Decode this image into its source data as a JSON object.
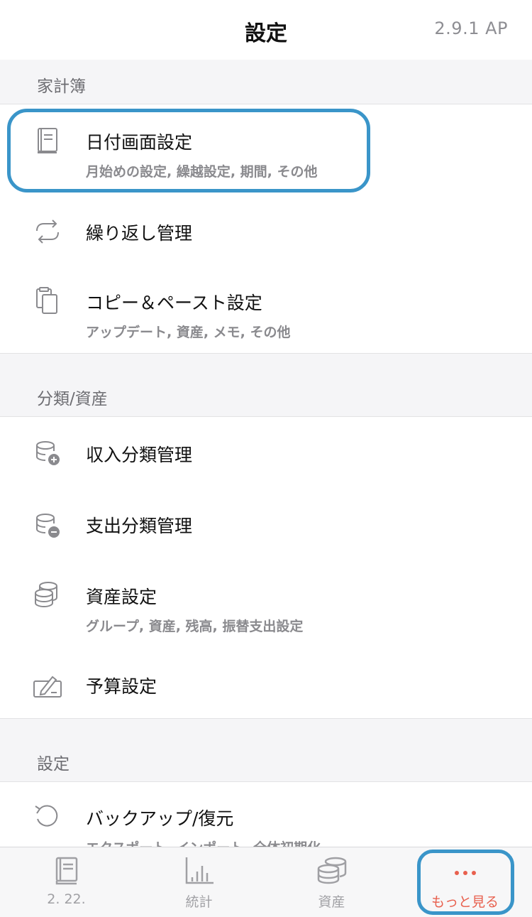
{
  "header": {
    "title": "設定",
    "version": "2.9.1 AP"
  },
  "sections": {
    "household": {
      "label": "家計簿",
      "items": [
        {
          "title": "日付画面設定",
          "subtitle": "月始めの設定, 繰越設定, 期間, その他",
          "icon": "book-icon"
        },
        {
          "title": "繰り返し管理",
          "icon": "repeat-icon"
        },
        {
          "title": "コピー＆ペースト設定",
          "subtitle": "アップデート, 資産, メモ, その他",
          "icon": "clipboard-icon"
        }
      ]
    },
    "category": {
      "label": "分類/資産",
      "items": [
        {
          "title": "収入分類管理",
          "icon": "coins-plus-icon"
        },
        {
          "title": "支出分類管理",
          "icon": "coins-minus-icon"
        },
        {
          "title": "資産設定",
          "subtitle": "グループ, 資産, 残高, 振替支出設定",
          "icon": "coins-icon"
        },
        {
          "title": "予算設定",
          "icon": "budget-icon"
        }
      ]
    },
    "settings": {
      "label": "設定",
      "items": [
        {
          "title": "バックアップ/復元",
          "subtitle": "エクスポート, インポート, 全体初期化",
          "icon": "restore-icon"
        }
      ]
    }
  },
  "tabbar": {
    "tabs": [
      {
        "label": "2. 22.",
        "icon": "book-icon"
      },
      {
        "label": "統計",
        "icon": "chart-icon"
      },
      {
        "label": "資産",
        "icon": "coins-icon"
      },
      {
        "label": "もっと見る",
        "icon": "more-icon"
      }
    ],
    "active_color": "#e8604e",
    "highlight_color": "#3a95c9"
  }
}
